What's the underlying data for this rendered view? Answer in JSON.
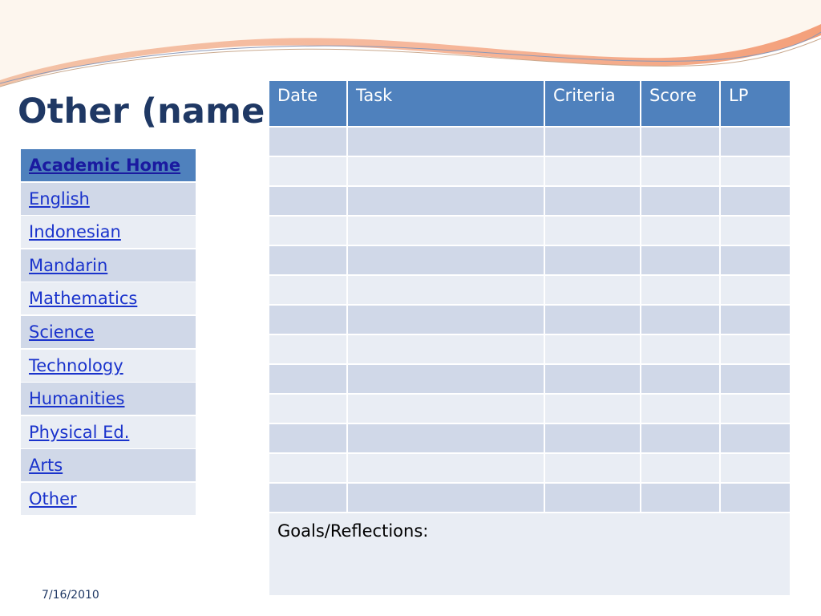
{
  "slide": {
    "title": "Other (name)",
    "date": "7/16/2010"
  },
  "nav": {
    "items": [
      {
        "label": "Academic Home"
      },
      {
        "label": "English"
      },
      {
        "label": "Indonesian"
      },
      {
        "label": "Mandarin"
      },
      {
        "label": "Mathematics"
      },
      {
        "label": "Science"
      },
      {
        "label": "Technology"
      },
      {
        "label": "Humanities"
      },
      {
        "label": "Physical Ed."
      },
      {
        "label": "Arts"
      },
      {
        "label": "Other"
      }
    ]
  },
  "table": {
    "headers": [
      "Date",
      "Task",
      "Criteria",
      "Score",
      "LP"
    ],
    "empty_rows": 13,
    "goals_label": "Goals/Reflections:"
  },
  "colors": {
    "header_blue": "#4f81bd",
    "row_dark": "#d0d8e8",
    "row_light": "#e9edf4",
    "title_navy": "#1f3864",
    "link_blue": "#1a33cc"
  }
}
